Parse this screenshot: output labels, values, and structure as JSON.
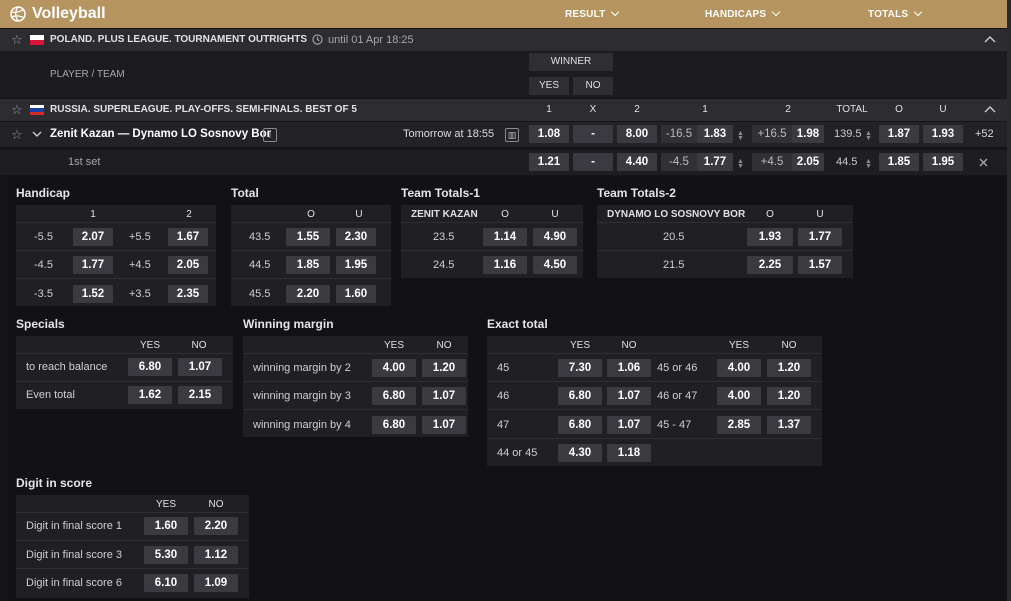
{
  "header": {
    "title": "Volleyball",
    "menu": [
      "RESULT",
      "HANDICAPS",
      "TOTALS"
    ]
  },
  "league1": {
    "name": "POLAND. PLUS LEAGUE. TOURNAMENT OUTRIGHTS",
    "time": "until 01 Apr 18:25",
    "player_team": "PLAYER / TEAM",
    "winner": "WINNER",
    "yes": "YES",
    "no": "NO"
  },
  "league2": {
    "name": "RUSSIA. SUPERLEAGUE. PLAY-OFFS. SEMI-FINALS. BEST OF 5",
    "cols": [
      "1",
      "X",
      "2",
      "1",
      "2",
      "TOTAL",
      "O",
      "U"
    ]
  },
  "match": {
    "name": "Zenit Kazan — Dynamo LO Sosnovy Bor",
    "time": "Tomorrow at 18:55",
    "odds": [
      "1.08",
      "-",
      "8.00",
      "-16.5",
      "1.83",
      "+16.5",
      "1.98",
      "139.5",
      "1.87",
      "1.93"
    ],
    "more": "+52"
  },
  "set1": {
    "label": "1st set",
    "odds": [
      "1.21",
      "-",
      "4.40",
      "-4.5",
      "1.77",
      "+4.5",
      "2.05",
      "44.5",
      "1.85",
      "1.95"
    ]
  },
  "handicap": {
    "title": "Handicap",
    "h1": "1",
    "h2": "2",
    "rows": [
      [
        "-5.5",
        "2.07",
        "+5.5",
        "1.67"
      ],
      [
        "-4.5",
        "1.77",
        "+4.5",
        "2.05"
      ],
      [
        "-3.5",
        "1.52",
        "+3.5",
        "2.35"
      ]
    ]
  },
  "total": {
    "title": "Total",
    "ho": "O",
    "hu": "U",
    "rows": [
      [
        "43.5",
        "1.55",
        "2.30"
      ],
      [
        "44.5",
        "1.85",
        "1.95"
      ],
      [
        "45.5",
        "2.20",
        "1.60"
      ]
    ]
  },
  "tt1": {
    "title": "Team Totals-1",
    "team": "ZENIT KAZAN",
    "ho": "O",
    "hu": "U",
    "rows": [
      [
        "23.5",
        "1.14",
        "4.90"
      ],
      [
        "24.5",
        "1.16",
        "4.50"
      ]
    ]
  },
  "tt2": {
    "title": "Team Totals-2",
    "team": "DYNAMO LO SOSNOVY BOR",
    "ho": "O",
    "hu": "U",
    "rows": [
      [
        "20.5",
        "1.93",
        "1.77"
      ],
      [
        "21.5",
        "2.25",
        "1.57"
      ]
    ]
  },
  "specials": {
    "title": "Specials",
    "hy": "YES",
    "hn": "NO",
    "rows": [
      [
        "to reach balance",
        "6.80",
        "1.07"
      ],
      [
        "Even total",
        "1.62",
        "2.15"
      ]
    ]
  },
  "winmargin": {
    "title": "Winning margin",
    "hy": "YES",
    "hn": "NO",
    "rows": [
      [
        "winning margin by 2",
        "4.00",
        "1.20"
      ],
      [
        "winning margin by 3",
        "6.80",
        "1.07"
      ],
      [
        "winning margin by 4",
        "6.80",
        "1.07"
      ]
    ]
  },
  "exact": {
    "title": "Exact total",
    "hy": "YES",
    "hn": "NO",
    "left": [
      [
        "45",
        "7.30",
        "1.06"
      ],
      [
        "46",
        "6.80",
        "1.07"
      ],
      [
        "47",
        "6.80",
        "1.07"
      ],
      [
        "44 or 45",
        "4.30",
        "1.18"
      ]
    ],
    "right": [
      [
        "45 or 46",
        "4.00",
        "1.20"
      ],
      [
        "46 or 47",
        "4.00",
        "1.20"
      ],
      [
        "45 - 47",
        "2.85",
        "1.37"
      ]
    ]
  },
  "digit": {
    "title": "Digit in score",
    "hy": "YES",
    "hn": "NO",
    "rows": [
      [
        "Digit in final score 1",
        "1.60",
        "2.20"
      ],
      [
        "Digit in final score 3",
        "5.30",
        "1.12"
      ],
      [
        "Digit in final score 6",
        "6.10",
        "1.09"
      ]
    ]
  }
}
